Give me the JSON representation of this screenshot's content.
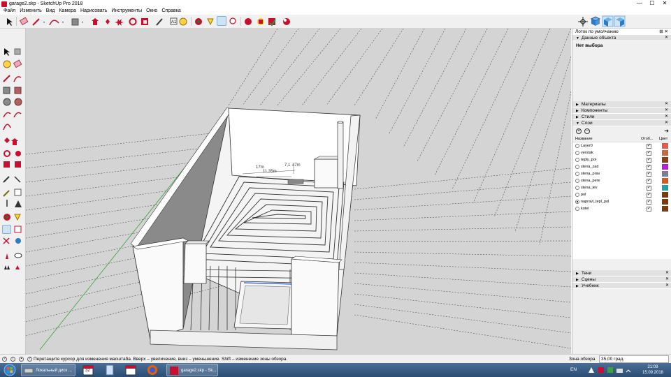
{
  "window": {
    "title": "garage2.skp - SketchUp Pro 2018",
    "minimize": "—",
    "maximize": "☐",
    "close": "✕"
  },
  "menu": [
    "Файл",
    "Изменить",
    "Вид",
    "Камера",
    "Нарисовать",
    "Инструменты",
    "Окно",
    "Справка"
  ],
  "tray": {
    "header": "Лоток по умолчанию",
    "entity_info": {
      "title": "Данные объекта",
      "no_selection": "Нет выбора"
    },
    "sections": [
      "Материалы",
      "Компоненты",
      "Стили",
      "Слои"
    ],
    "layers": {
      "columns": {
        "name": "Название",
        "visible": "Отоб...",
        "color": "Цвет"
      },
      "rows": [
        {
          "name": "Layer0",
          "active": false,
          "visible": true,
          "color": "#e8574a"
        },
        {
          "name": "verstak",
          "active": false,
          "visible": true,
          "color": "#c8683b"
        },
        {
          "name": "teply_pol",
          "active": false,
          "visible": true,
          "color": "#8a3f12"
        },
        {
          "name": "stena_zad",
          "active": false,
          "visible": true,
          "color": "#b41fd8"
        },
        {
          "name": "stena_prav",
          "active": false,
          "visible": true,
          "color": "#7c7c98"
        },
        {
          "name": "stena_pere",
          "active": false,
          "visible": true,
          "color": "#d05a20"
        },
        {
          "name": "stena_lev",
          "active": false,
          "visible": true,
          "color": "#20a0a8"
        },
        {
          "name": "pol",
          "active": false,
          "visible": true,
          "color": "#7a3a10"
        },
        {
          "name": "napravl_tepl_pol",
          "active": true,
          "visible": true,
          "color": "#7a3a10"
        },
        {
          "name": "kotel",
          "active": false,
          "visible": true,
          "color": "#7a3a10"
        }
      ]
    },
    "bottom_sections": [
      "Тени",
      "Сцены",
      "Учебник"
    ]
  },
  "viewport": {
    "dimension_label_1": "7,1",
    "dimension_label_2": "47m",
    "dimension_label_3": "17m",
    "dimension_label_4": "11,35m"
  },
  "status": {
    "hint": "Перетащите курсор для изменения масштаба. Вверх – увеличение, вниз – уменьшение. Shift – изменение зоны обзора.",
    "vcb_label": "Зона обзора",
    "vcb_value": "35,00 град."
  },
  "taskbar": {
    "explorer_label": "Локальный диск ...",
    "sketchup_label": "garage2.skp - Sk...",
    "calendar_num": "32",
    "lang": "EN",
    "time": "21:09",
    "date": "15.09.2018"
  },
  "colors": {
    "accent": "#c8102e",
    "taskbar": "#2c4d74",
    "viewport_bg": "#d4d4d4",
    "wall_inner": "#7a7a7a",
    "wall_light": "#ffffff"
  }
}
